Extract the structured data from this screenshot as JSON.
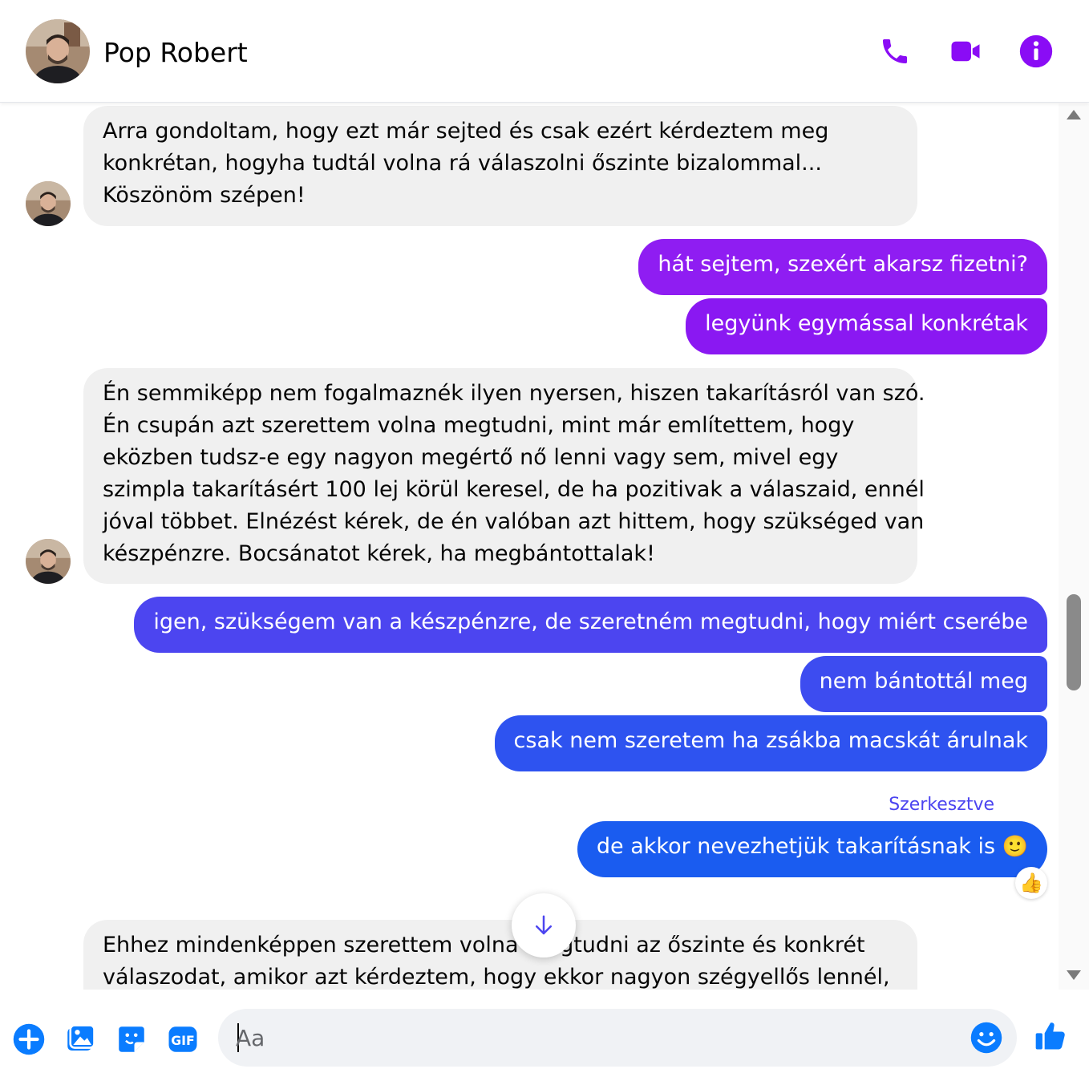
{
  "header": {
    "contact_name": "Pop Robert",
    "icons": [
      "phone-icon",
      "video-camera-icon",
      "info-icon"
    ]
  },
  "colors": {
    "accent": "#8a0cf5",
    "out_purple": "#8f1df2",
    "out_indigo": "#4c45f0",
    "out_blue": "#1a5cf0",
    "incoming_bg": "#f0f0f0",
    "composer_icon": "#0a7cff"
  },
  "messages": [
    {
      "direction": "in",
      "lines": [
        "Arra gondoltam, hogy ezt már sejted és csak ezért kérdeztem meg",
        "konkrétan, hogyha tudtál volna rá válaszolni őszinte bizalommal...",
        "Köszönöm szépen!"
      ]
    },
    {
      "direction": "out",
      "text": "hát sejtem, szexért akarsz fizetni?"
    },
    {
      "direction": "out",
      "text": "legyünk egymással konkrétak"
    },
    {
      "direction": "in",
      "lines": [
        "Én semmiképp nem fogalmaznék ilyen nyersen, hiszen takarításról van szó.",
        "Én csupán azt szerettem volna megtudni, mint már említettem, hogy",
        "eközben tudsz-e egy nagyon megértő nő lenni vagy sem, mivel egy",
        "szimpla takarításért 100 lej körül keresel, de ha pozitivak a válaszaid, ennél",
        "jóval többet. Elnézést kérek, de én valóban azt hittem, hogy szükséged van",
        "készpénzre. Bocsánatot kérek, ha megbántottalak!"
      ]
    },
    {
      "direction": "out",
      "text": "igen, szükségem van a készpénzre, de szeretném megtudni, hogy miért cserébe"
    },
    {
      "direction": "out",
      "text": "nem bántottál meg"
    },
    {
      "direction": "out",
      "text": "csak nem szeretem ha zsákba macskát árulnak"
    },
    {
      "direction": "out",
      "edited_label": "Szerkesztve",
      "text": "de akkor nevezhetjük takarításnak is",
      "emoji": "🙂",
      "reaction": "👍"
    },
    {
      "direction": "in",
      "lines": [
        "Ehhez mindenképpen szerettem volna megtudni az őszinte és konkrét",
        "válaszodat, amikor azt kérdeztem, hogy ekkor nagyon szégyellős lennél,"
      ]
    }
  ],
  "composer": {
    "placeholder": "Aa",
    "icons": [
      "plus-icon",
      "image-icon",
      "sticker-icon",
      "gif-icon",
      "emoji-icon",
      "thumbs-up-icon"
    ],
    "gif_label": "GIF"
  }
}
